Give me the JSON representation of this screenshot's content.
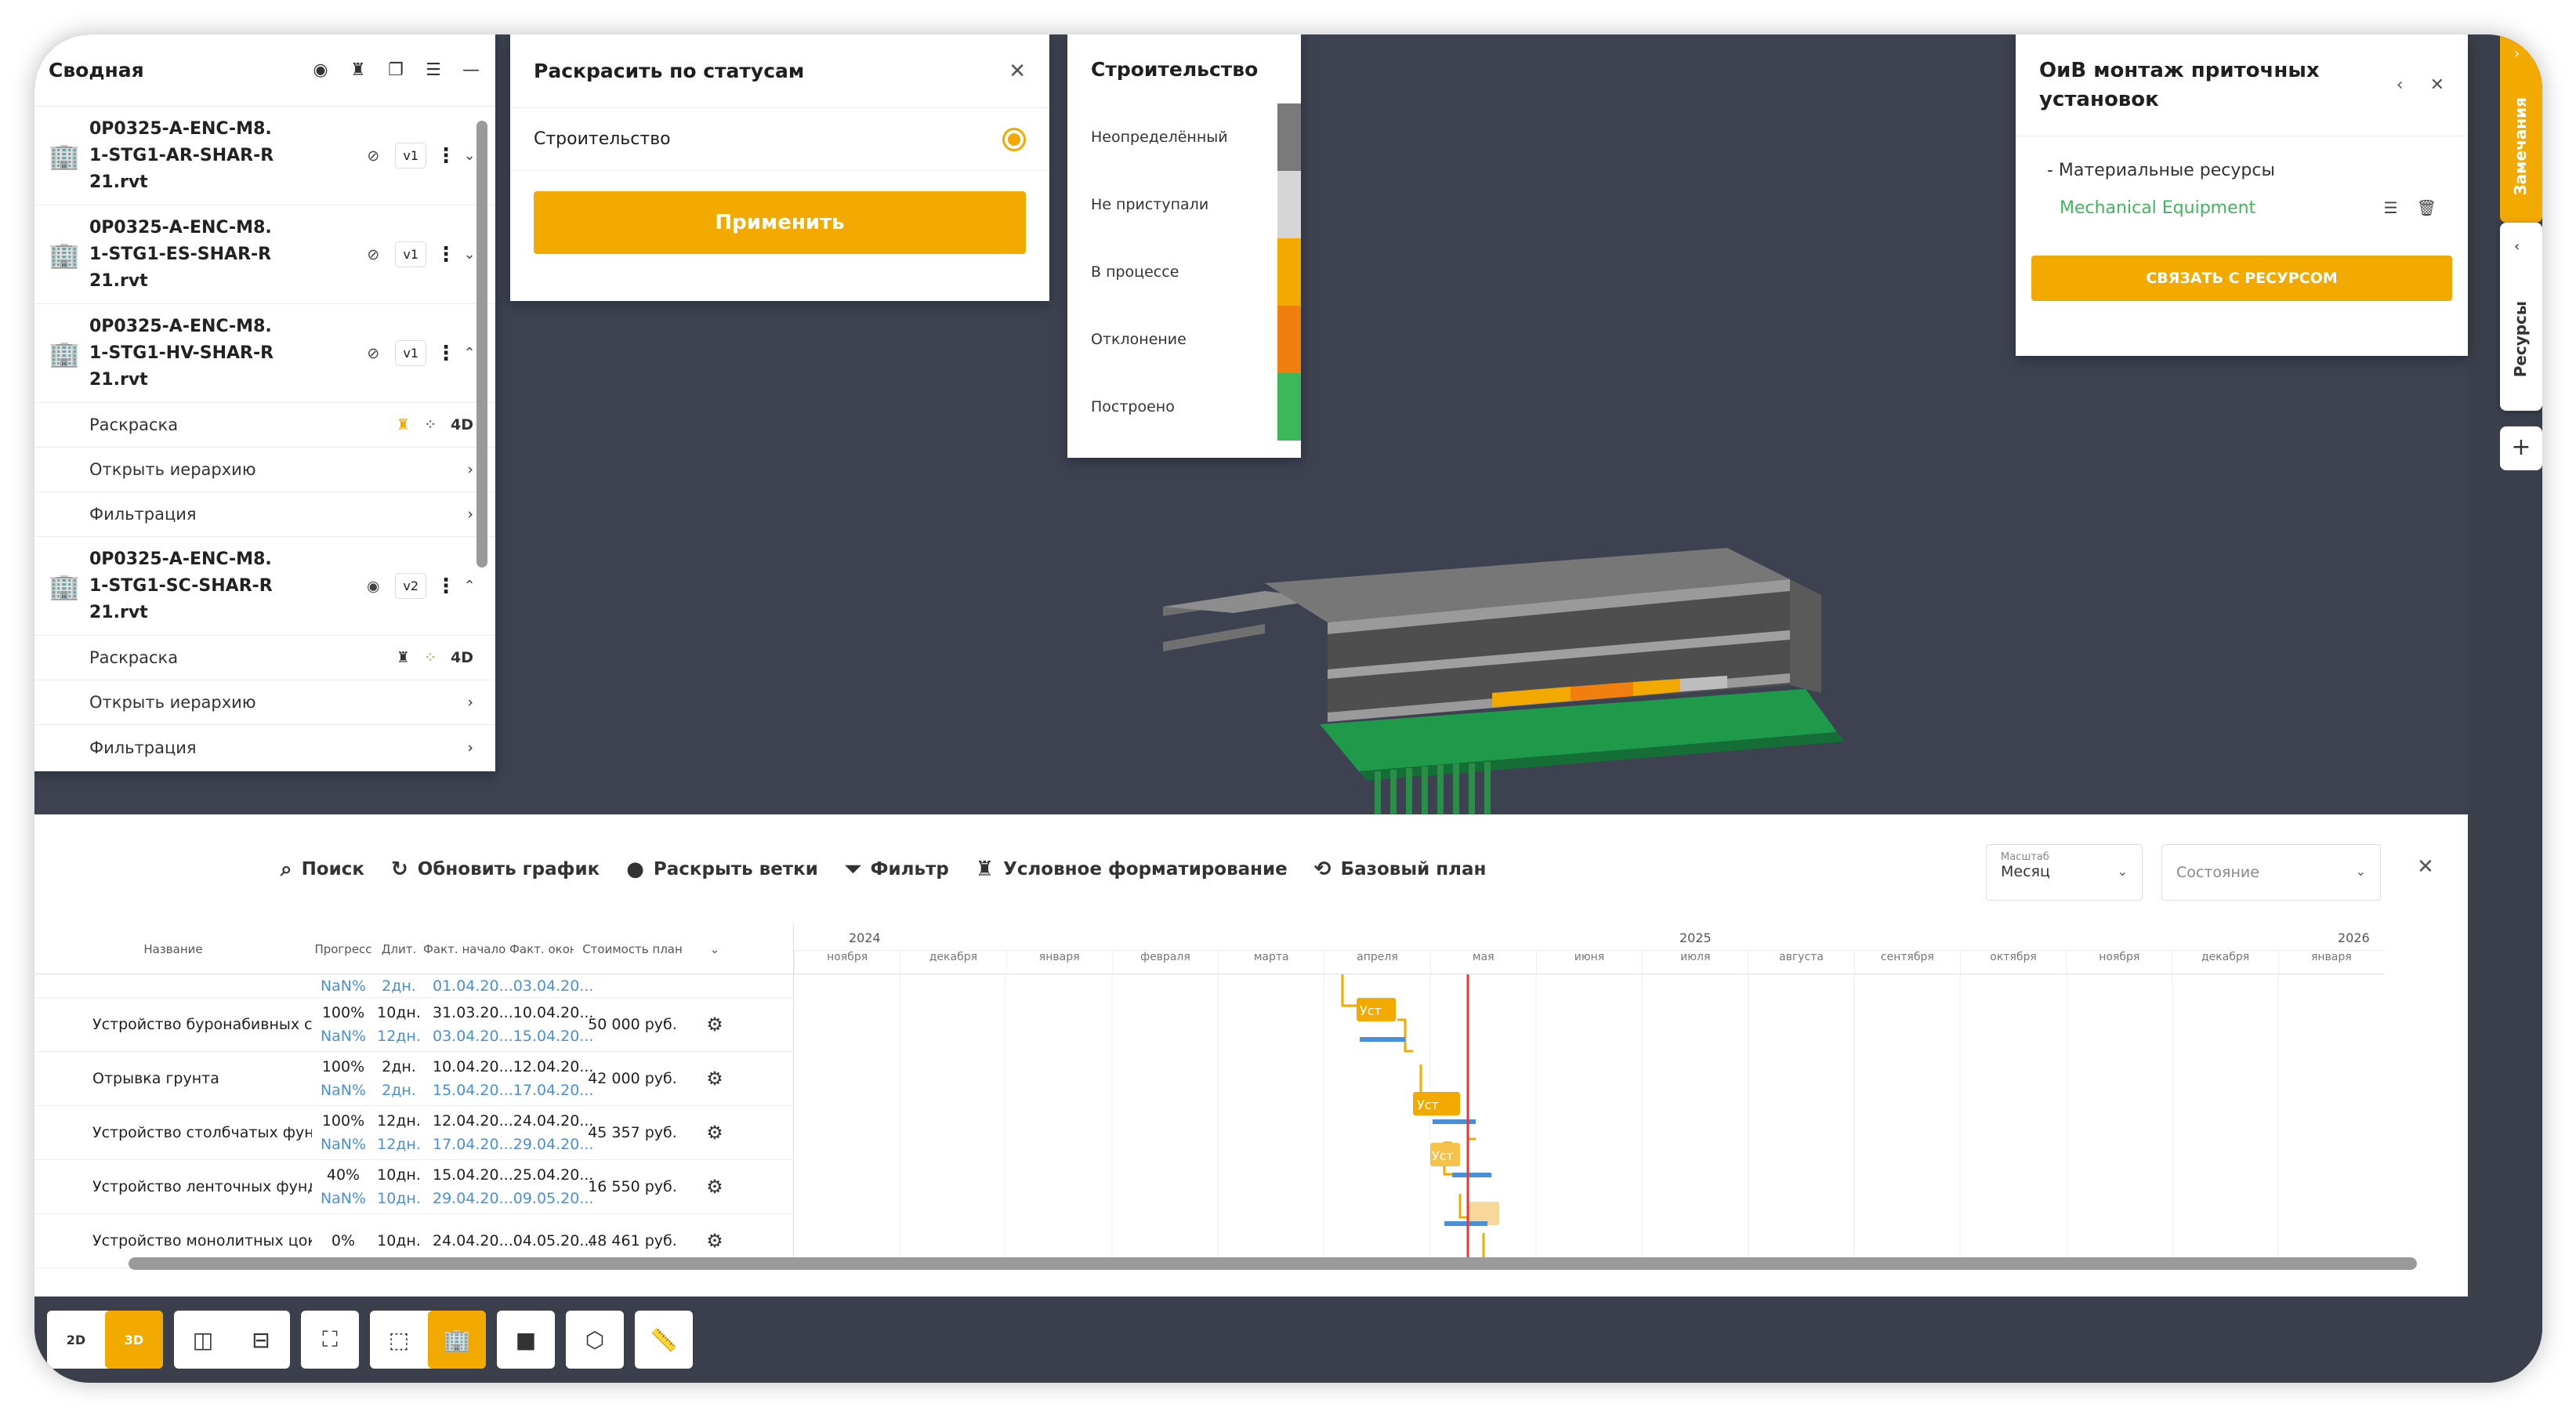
{
  "tree": {
    "title": "Сводная",
    "models": [
      {
        "name_lines": [
          "0P0325-A-ENC-M8.",
          "1-STG1-AR-SHAR-R",
          "21.rvt"
        ],
        "version": "v1",
        "chev": "⌄"
      },
      {
        "name_lines": [
          "0P0325-A-ENC-M8.",
          "1-STG1-ES-SHAR-R",
          "21.rvt"
        ],
        "version": "v1",
        "chev": "⌄"
      },
      {
        "name_lines": [
          "0P0325-A-ENC-M8.",
          "1-STG1-HV-SHAR-R",
          "21.rvt"
        ],
        "version": "v1",
        "chev": "⌃"
      },
      {
        "name_lines": [
          "0P0325-A-ENC-M8.",
          "1-STG1-SC-SHAR-R",
          "21.rvt"
        ],
        "version": "v2",
        "chev": "⌃"
      }
    ],
    "sub_coloring": "Раскраска",
    "sub_4d": "4D",
    "sub_hierarchy": "Открыть иерархию",
    "sub_filter": "Фильтрация"
  },
  "status_panel": {
    "title": "Раскрасить по статусам",
    "option": "Строительство",
    "apply": "Применить"
  },
  "legend": {
    "title": "Строительство",
    "items": [
      {
        "label": "Неопределённый",
        "color": "#7a7a7a"
      },
      {
        "label": "Не приступали",
        "color": "#d6d6d6"
      },
      {
        "label": "В процессе",
        "color": "#f2a900"
      },
      {
        "label": "Отклонение",
        "color": "#f07f10"
      },
      {
        "label": "Построено",
        "color": "#3cb85a"
      }
    ]
  },
  "resource_panel": {
    "title_line1": "ОиВ монтаж приточных",
    "title_line2": "установок",
    "group": "- Материальные ресурсы",
    "item": "Mechanical Equipment",
    "link_button": "СВЯЗАТЬ С РЕСУРСОМ"
  },
  "side_tabs": {
    "notes": "Замечания",
    "resources": "Ресурсы"
  },
  "toolbar": {
    "search": "Поиск",
    "refresh": "Обновить график",
    "expand": "Раскрыть ветки",
    "filter": "Фильтр",
    "cond_format": "Условное форматирование",
    "baseline": "Базовый план",
    "scale_caption": "Масштаб",
    "scale_value": "Месяц",
    "state_placeholder": "Состояние"
  },
  "table": {
    "headers": {
      "name": "Название",
      "progress": "Прогресс",
      "duration": "Длит.",
      "dates": "Факт. начало  Факт. окон...",
      "cost": "Стоимость план"
    },
    "rows": [
      {
        "name": "Устройство буронабивных св",
        "progress": "100%",
        "progress2": "NaN%",
        "dur": "10дн.",
        "dur2": "12дн.",
        "dates": "31.03.20...10.04.20...",
        "dates2": "03.04.20...15.04.20...",
        "cost": "50 000 руб."
      },
      {
        "name": "Отрывка грунта",
        "progress": "100%",
        "progress2": "NaN%",
        "dur": "2дн.",
        "dur2": "2дн.",
        "dates": "10.04.20...12.04.20...",
        "dates2": "15.04.20...17.04.20...",
        "cost": "42 000 руб."
      },
      {
        "name": "Устройство столбчатых фунд",
        "progress": "100%",
        "progress2": "NaN%",
        "dur": "12дн.",
        "dur2": "12дн.",
        "dates": "12.04.20...24.04.20...",
        "dates2": "17.04.20...29.04.20...",
        "cost": "45 357 руб."
      },
      {
        "name": "Устройство ленточных фунд",
        "progress": "40%",
        "progress2": "NaN%",
        "dur": "10дн.",
        "dur2": "10дн.",
        "dates": "15.04.20...25.04.20...",
        "dates2": "29.04.20...09.05.20...",
        "cost": "16 550 руб."
      },
      {
        "name": "Устройство монолитных цок",
        "progress": "0%",
        "progress2": "",
        "dur": "10дн.",
        "dur2": "",
        "dates": "24.04.20...04.05.20...",
        "dates2": "",
        "cost": "48 461 руб."
      }
    ],
    "top_partial": {
      "progress": "NaN%",
      "dur": "2дн.",
      "dates": "01.04.20...03.04.20..."
    }
  },
  "timeline": {
    "years": [
      "2024",
      "2025",
      "2026"
    ],
    "months": [
      "ноября",
      "декабря",
      "января",
      "февраля",
      "марта",
      "апреля",
      "мая",
      "июня",
      "июля",
      "августа",
      "сентября",
      "октября",
      "ноября",
      "декабря",
      "января"
    ],
    "bar_label": "Уст"
  },
  "bottom_tools": {
    "view2d": "2D",
    "view3d": "3D"
  }
}
